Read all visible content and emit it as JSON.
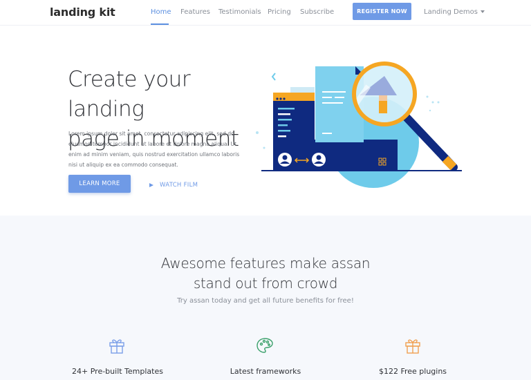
{
  "brand": {
    "logo": "landing kit"
  },
  "nav": {
    "items": [
      {
        "label": "Home",
        "active": true
      },
      {
        "label": "Features",
        "active": false
      },
      {
        "label": "Testimonials",
        "active": false
      },
      {
        "label": "Pricing",
        "active": false
      },
      {
        "label": "Subscribe",
        "active": false
      }
    ],
    "register_label": "REGISTER NOW",
    "demos_label": "Landing Demos"
  },
  "hero": {
    "title_line1": "Create your landing",
    "title_line2": "page in moment",
    "text": "Lorem ipsum dolor sit amet, consectetur adipiscing elit, sed do eiusmod tempor incididunt ut labore et dolore magna aliqua. Ut enim ad minim veniam, quis nostrud exercitation ullamco laboris nisi ut aliquip ex ea commodo consequat.",
    "learn_more_label": "LEARN MORE",
    "watch_film_label": "WATCH FILM"
  },
  "features": {
    "title_line1": "Awesome features make assan",
    "title_line2": "stand out from crowd",
    "subtitle": "Try assan today and get all future benefits for free!",
    "items": [
      {
        "label": "24+ Pre-built Templates",
        "icon": "gift-icon"
      },
      {
        "label": "Latest frameworks",
        "icon": "palette-icon"
      },
      {
        "label": "$122 Free plugins",
        "icon": "gift-icon"
      }
    ]
  },
  "colors": {
    "accent": "#6f9ae6",
    "navy": "#0f2a80",
    "orange": "#f5a623",
    "light_blue": "#6ecbea",
    "palette_green": "#3aa06a",
    "gift_orange": "#f0a050"
  }
}
